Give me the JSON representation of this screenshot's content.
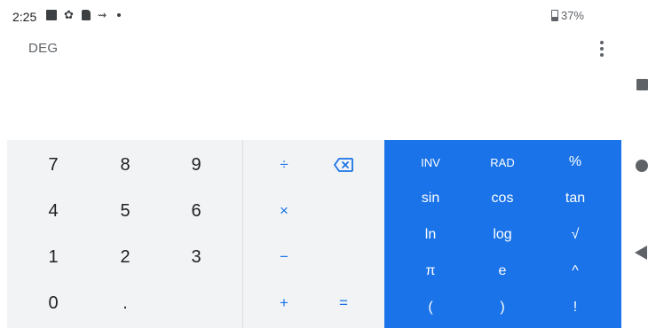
{
  "status": {
    "time": "2:25",
    "icons": [
      "image-icon",
      "gear-icon",
      "sd-card-icon",
      "network-icon",
      "dot-icon"
    ],
    "battery": "37%"
  },
  "header": {
    "mode": "DEG"
  },
  "numpad": {
    "keys": [
      "7",
      "8",
      "9",
      "4",
      "5",
      "6",
      "1",
      "2",
      "3",
      "0",
      "."
    ]
  },
  "operators": {
    "divide": "÷",
    "multiply": "×",
    "minus": "−",
    "plus": "+",
    "equals": "="
  },
  "advanced": {
    "keys": [
      "INV",
      "RAD",
      "%",
      "sin",
      "cos",
      "tan",
      "ln",
      "log",
      "√",
      "π",
      "e",
      "^",
      "(",
      ")",
      "!"
    ]
  },
  "colors": {
    "accent": "#1a73e8",
    "pad_bg": "#f1f3f4",
    "text": "#202124"
  }
}
